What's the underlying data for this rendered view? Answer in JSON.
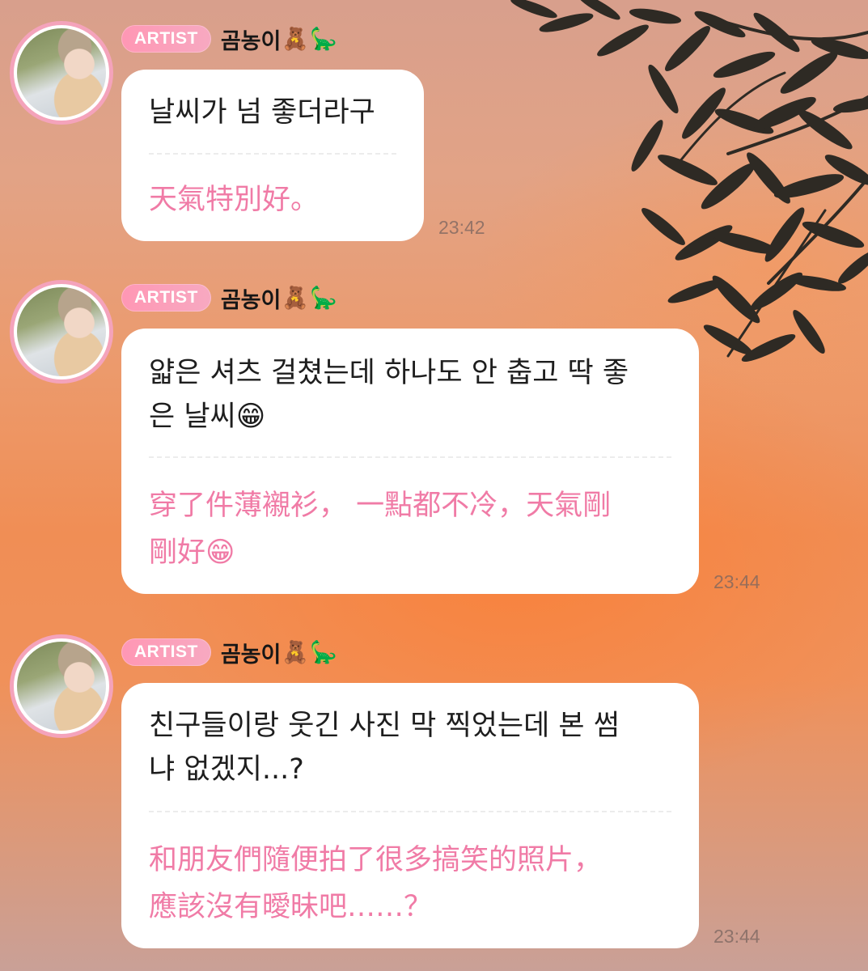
{
  "colors": {
    "badge": "#ff97b4",
    "translation_text": "#f07ba6",
    "bubble": "#ffffff",
    "avatar_border": "#f4a3bb"
  },
  "messages": [
    {
      "badge": "ARTIST",
      "nickname": "곰농이",
      "emojis": [
        "🧸",
        "🦕"
      ],
      "korean_line1": "날씨가 넘 좋더라구",
      "korean_line2": "",
      "chinese_line1": "天氣特別好。",
      "chinese_line2": "",
      "time": "23:42"
    },
    {
      "badge": "ARTIST",
      "nickname": "곰농이",
      "emojis": [
        "🧸",
        "🦕"
      ],
      "korean_line1": "얇은 셔츠 걸쳤는데 하나도 안 춥고 딱 좋",
      "korean_line2": "은 날씨😁",
      "chinese_line1": "穿了件薄襯衫， 一點都不冷，天氣剛",
      "chinese_line2": "剛好😁",
      "time": "23:44"
    },
    {
      "badge": "ARTIST",
      "nickname": "곰농이",
      "emojis": [
        "🧸",
        "🦕"
      ],
      "korean_line1": "친구들이랑 웃긴 사진 막 찍었는데 본 썸",
      "korean_line2": "냐 없겠지...?",
      "chinese_line1": "和朋友們隨便拍了很多搞笑的照片，",
      "chinese_line2": "應該沒有曖昧吧……？",
      "time": "23:44"
    }
  ]
}
